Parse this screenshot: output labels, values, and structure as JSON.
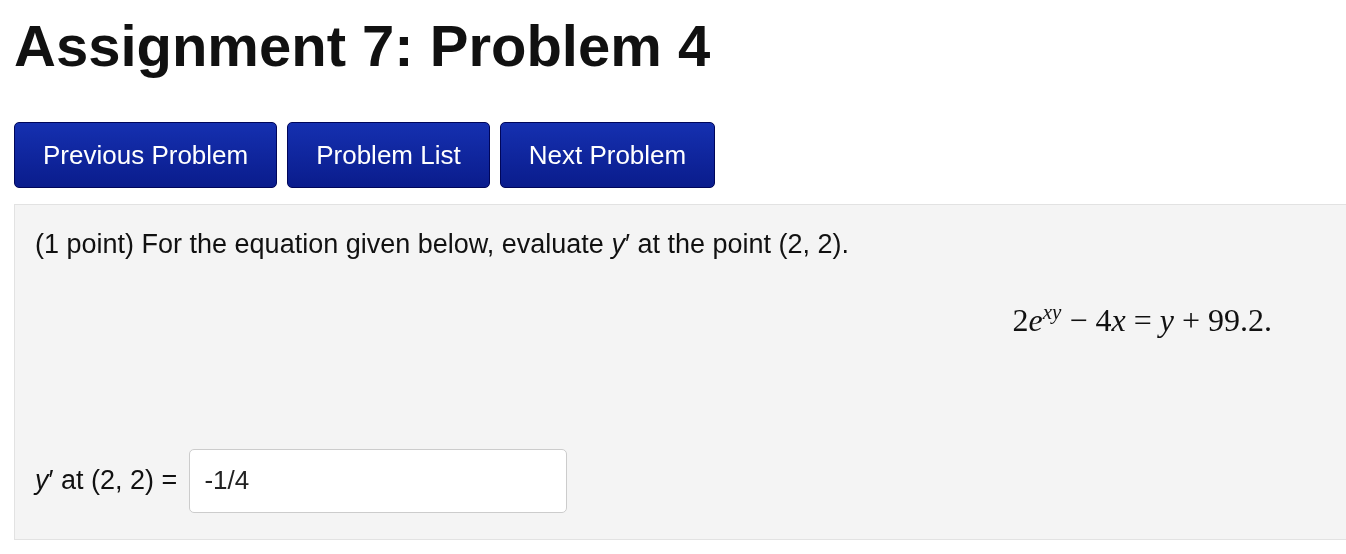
{
  "title": "Assignment 7: Problem 4",
  "nav_buttons": [
    "Previous Problem",
    "Problem List",
    "Next Problem"
  ],
  "problem": {
    "statement": "(1 point) For the equation given below, evaluate *y*′ at the point (2, 2).",
    "equation": [
      "2",
      "*e*$^{xy}$",
      " − 4",
      "*x*",
      " = ",
      "*y*",
      " + 99.2."
    ],
    "answer_label": "*y*′ at (2, 2) =",
    "answer_value": "-1/4"
  }
}
